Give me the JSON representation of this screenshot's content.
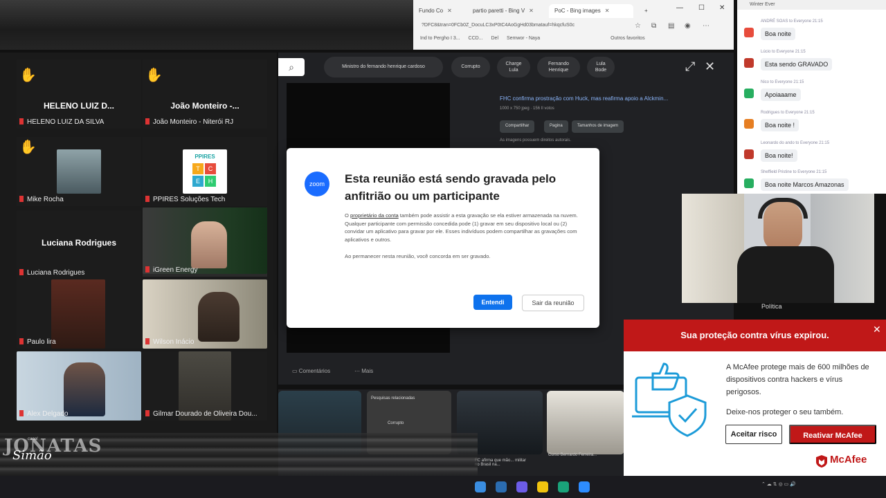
{
  "browser": {
    "tabs": [
      {
        "label": "Fundo Co"
      },
      {
        "label": "partio paretti - Bing V"
      },
      {
        "label": "PoC - Bing images"
      }
    ],
    "address": "?DFC8&tran=0FCb0Z_DocuLC3xP0tC4AoGgHd03bmatauf=hkqcfuS0c",
    "bookmarks": [
      "Ind to Pergho I 3...",
      "CCD...",
      "Del",
      "Semwor - Naya"
    ],
    "bookmarks_right": "Outros favoritos"
  },
  "gallery": {
    "tiles": [
      {
        "big": "HELENO LUIZ D...",
        "label": "HELENO LUIZ DA SILVA",
        "hand": "✋"
      },
      {
        "big": "João Monteiro -...",
        "label": "João Monteiro - Niterói RJ",
        "hand": "✋"
      },
      {
        "label": "Mike Rocha",
        "hand": "✋"
      },
      {
        "label": "PPIRES Soluções Tech",
        "logo": [
          "PPIRES",
          "T",
          "C",
          "E",
          "H"
        ]
      },
      {
        "big": "Luciana Rodrigues",
        "label": "Luciana Rodrigues"
      },
      {
        "label": "iGreen Energy"
      },
      {
        "label": "Paulo lira"
      },
      {
        "label": "Wilson Inácio"
      },
      {
        "label": "Alex Delgado"
      },
      {
        "label": "Gilmar Dourado de Oliveira Dou..."
      }
    ]
  },
  "viewer": {
    "search_icon": "search-icon",
    "chips": [
      {
        "label": "Ministro do fernando henrique cardoso"
      },
      {
        "label": "Corrupto"
      },
      {
        "label": "Charge Lula"
      },
      {
        "label": "Fernando Henrique"
      },
      {
        "label": "Lula Bode"
      }
    ],
    "info_title": "FHC confirma prostração com Huck, mas reafirma apoio a Alckmin...",
    "info_sub": "1000 x 750 jpeg · 156 Il votos",
    "info_buttons": [
      "Compartilhar",
      "Pagina",
      "Tamanhos de imagem"
    ],
    "info_note": "As imagens possuem direitos autorais.",
    "lower_links": [
      "Comentários",
      "Mais"
    ],
    "thumb_caption_1": "Pesquisas relacionadas",
    "thumb_caption_1b": "Corrupto",
    "thumb_caption_2": "FC afirma que mão... militar no Brasil na...",
    "thumb_caption_3": "Curso Bernardo Ferreira..."
  },
  "chat": {
    "header": "Winter Ever",
    "messages": [
      {
        "meta": "ANDRÉ SOAS to Everyone 21:15",
        "text": "Boa noite",
        "color": "#e74c3c"
      },
      {
        "meta": "Lúcio to Everyone 21:15",
        "text": "Esta sendo GRAVADO",
        "color": "#c0392b"
      },
      {
        "meta": "Nico to Everyone 21:15",
        "text": "Apoiaaame",
        "color": "#27ae60"
      },
      {
        "meta": "Rodrigues to Everyone 21:15",
        "text": "Boa noite !",
        "color": "#e67e22"
      },
      {
        "meta": "Leonardo do ando to Everyone 21:15",
        "text": "Boa noite!",
        "color": "#c0392b"
      },
      {
        "meta": "Sheffield Pristine to Everyone 21:15",
        "text": "Boa noite Marcos Amazonas",
        "color": "#27ae60"
      }
    ]
  },
  "cam": {
    "label": "Política"
  },
  "dialog": {
    "logo": "zoom",
    "title": "Esta reunião está sendo gravada pelo anfitrião ou um participante",
    "body_link": "proprietário da conta",
    "body_pre": "O ",
    "body_post": " também pode assistir a esta gravação se ela estiver armazenada na nuvem. Qualquer participante com permissão concedida pode (1) gravar em seu dispositivo local ou (2) convidar um aplicativo para gravar por ele. Esses indivíduos podem compartilhar as gravações com aplicativos e outros.",
    "note": "Ao permanecer nesta reunião, você concorda em ser gravado.",
    "primary_button": "Entendi",
    "secondary_button": "Sair da reunião"
  },
  "mcafee": {
    "header": "Sua proteção contra vírus expirou.",
    "text": "A McAfee protege mais de 600 milhões de dispositivos contra hackers e vírus perigosos.",
    "text2": "Deixe-nos proteger o seu também.",
    "button_decline": "Aceitar risco",
    "button_accept": "Reativar McAfee",
    "brand": "McAfee",
    "accent": "#c01818"
  },
  "watermark": {
    "top": "canal",
    "line1": "JONATAS",
    "line2": "Simão"
  }
}
